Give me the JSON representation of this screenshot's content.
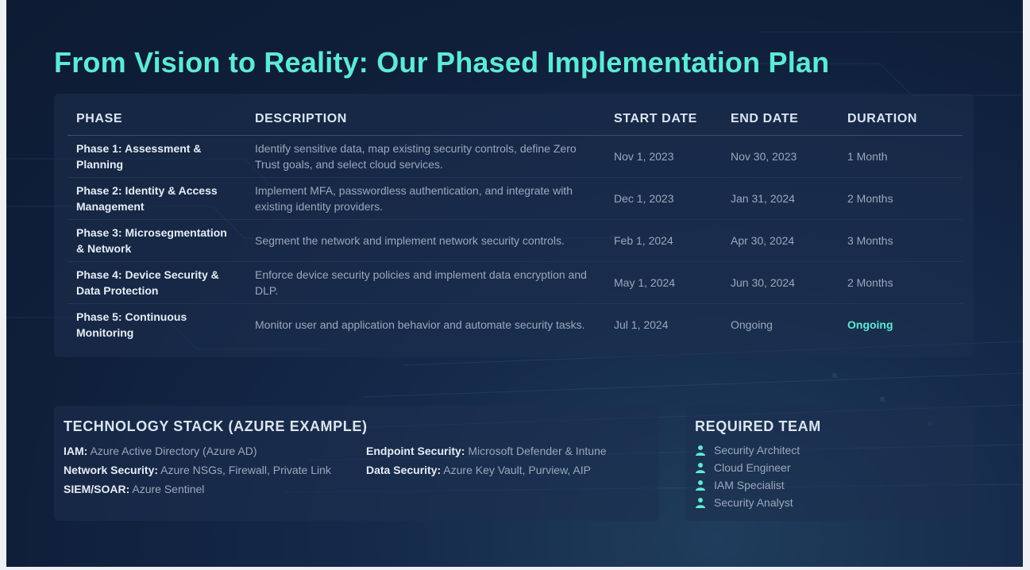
{
  "title": "From Vision to Reality: Our Phased Implementation Plan",
  "table": {
    "headers": [
      "PHASE",
      "DESCRIPTION",
      "START DATE",
      "END DATE",
      "DURATION"
    ],
    "rows": [
      {
        "phase": "Phase 1: Assessment & Planning",
        "description": "Identify sensitive data, map existing security controls, define Zero Trust goals, and select cloud services.",
        "start": "Nov 1, 2023",
        "end": "Nov 30, 2023",
        "duration": "1 Month"
      },
      {
        "phase": "Phase 2: Identity & Access Management",
        "description": "Implement MFA, passwordless authentication, and integrate with existing identity providers.",
        "start": "Dec 1, 2023",
        "end": "Jan 31, 2024",
        "duration": "2 Months"
      },
      {
        "phase": "Phase 3: Microsegmentation & Network",
        "description": "Segment the network and implement network security controls.",
        "start": "Feb 1, 2024",
        "end": "Apr 30, 2024",
        "duration": "3 Months"
      },
      {
        "phase": "Phase 4: Device Security & Data Protection",
        "description": "Enforce device security policies and implement data encryption and DLP.",
        "start": "May 1, 2024",
        "end": "Jun 30, 2024",
        "duration": "2 Months"
      },
      {
        "phase": "Phase 5: Continuous Monitoring",
        "description": "Monitor user and application behavior and automate security tasks.",
        "start": "Jul 1, 2024",
        "end": "Ongoing",
        "duration": "Ongoing"
      }
    ]
  },
  "tech_stack": {
    "title": "TECHNOLOGY STACK (AZURE EXAMPLE)",
    "items": [
      {
        "label": "IAM:",
        "value": "Azure Active Directory (Azure AD)"
      },
      {
        "label": "Network Security:",
        "value": "Azure NSGs, Firewall, Private Link"
      },
      {
        "label": "SIEM/SOAR:",
        "value": "Azure Sentinel"
      },
      {
        "label": "Endpoint Security:",
        "value": "Microsoft Defender & Intune"
      },
      {
        "label": "Data Security:",
        "value": "Azure Key Vault, Purview, AIP"
      }
    ]
  },
  "team": {
    "title": "REQUIRED TEAM",
    "icon": "user-icon",
    "members": [
      "Security Architect",
      "Cloud Engineer",
      "IAM Specialist",
      "Security Analyst"
    ]
  },
  "colors": {
    "accent": "#5eead4",
    "background": "#0f1f3a",
    "card": "#1e304e"
  }
}
